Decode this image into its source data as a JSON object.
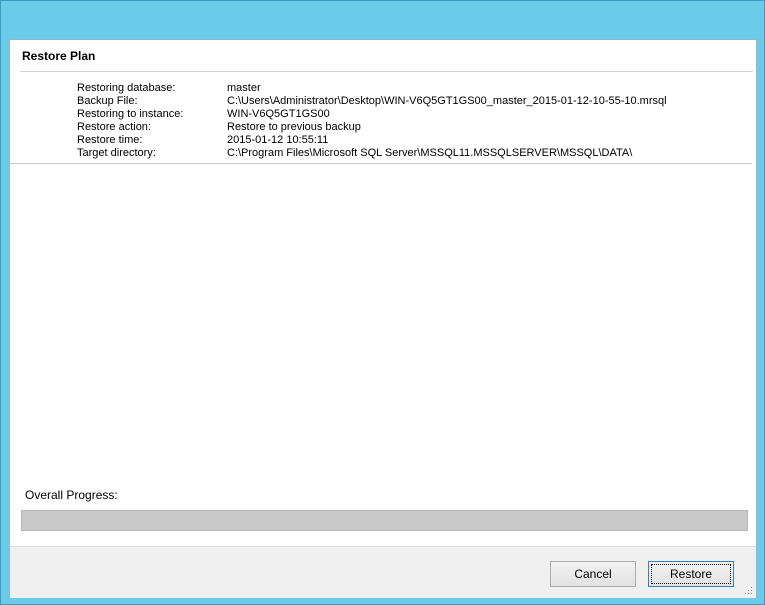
{
  "dialog": {
    "title": "Restore Plan"
  },
  "restore_info": [
    {
      "label": "Restoring database:",
      "value": "master"
    },
    {
      "label": "Backup File:",
      "value": "C:\\Users\\Administrator\\Desktop\\WIN-V6Q5GT1GS00_master_2015-01-12-10-55-10.mrsql"
    },
    {
      "label": "Restoring to instance:",
      "value": "WIN-V6Q5GT1GS00"
    },
    {
      "label": "Restore action:",
      "value": "Restore to previous backup"
    },
    {
      "label": "Restore time:",
      "value": "2015-01-12 10:55:11"
    },
    {
      "label": "Target directory:",
      "value": "C:\\Program Files\\Microsoft SQL Server\\MSSQL11.MSSQLSERVER\\MSSQL\\DATA\\"
    }
  ],
  "progress": {
    "label": "Overall Progress:",
    "percent": 0
  },
  "buttons": {
    "cancel": "Cancel",
    "restore": "Restore"
  },
  "colors": {
    "window_border": "#6ccbe9",
    "progress_track": "#c9c9c9"
  }
}
